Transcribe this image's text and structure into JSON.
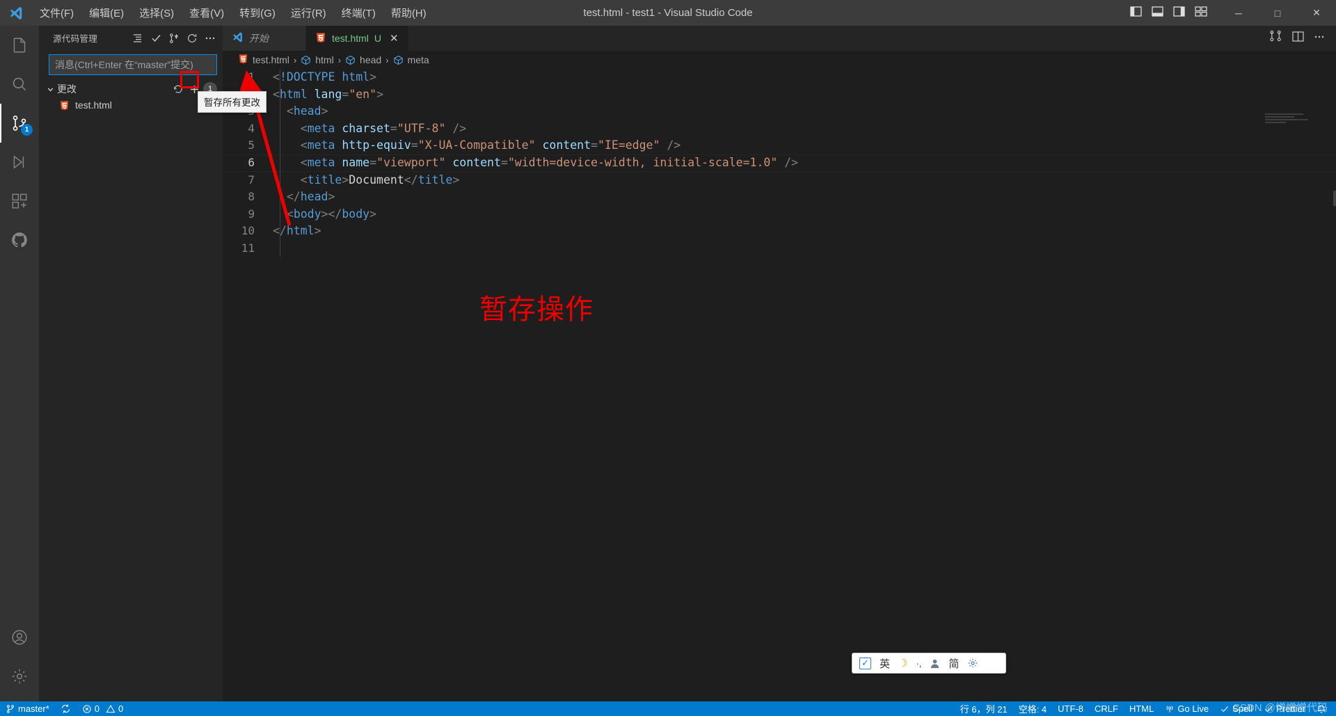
{
  "titlebar": {
    "logo_icon": "vscode-logo-icon",
    "title": "test.html - test1 - Visual Studio Code",
    "menus": [
      {
        "label": "文件(F)"
      },
      {
        "label": "编辑(E)"
      },
      {
        "label": "选择(S)"
      },
      {
        "label": "查看(V)"
      },
      {
        "label": "转到(G)"
      },
      {
        "label": "运行(R)"
      },
      {
        "label": "终端(T)"
      },
      {
        "label": "帮助(H)"
      }
    ],
    "layout_icons": [
      {
        "name": "toggle-primary-sidebar-icon"
      },
      {
        "name": "toggle-panel-icon"
      },
      {
        "name": "toggle-secondary-sidebar-icon"
      },
      {
        "name": "customize-layout-icon"
      }
    ],
    "window_controls": {
      "minimize": "─",
      "maximize": "□",
      "close": "✕"
    }
  },
  "activitybar": {
    "items": [
      {
        "name": "explorer",
        "icon": "files-icon",
        "badge": ""
      },
      {
        "name": "search",
        "icon": "search-icon",
        "badge": ""
      },
      {
        "name": "source-control",
        "icon": "source-control-icon",
        "badge": "1",
        "active": true
      },
      {
        "name": "run-and-debug",
        "icon": "debug-icon",
        "badge": ""
      },
      {
        "name": "extensions",
        "icon": "extensions-icon",
        "badge": ""
      },
      {
        "name": "github",
        "icon": "github-icon",
        "badge": ""
      }
    ],
    "bottom": [
      {
        "name": "accounts",
        "icon": "account-icon"
      },
      {
        "name": "manage",
        "icon": "gear-icon"
      }
    ]
  },
  "sidebar": {
    "title": "源代码管理",
    "header_actions": [
      {
        "name": "view-as-list",
        "icon": "list-icon"
      },
      {
        "name": "commit",
        "icon": "check-icon"
      },
      {
        "name": "more-branches",
        "icon": "branch-icon"
      },
      {
        "name": "refresh",
        "icon": "refresh-icon"
      },
      {
        "name": "views-and-more-actions",
        "icon": "ellipsis-icon"
      }
    ],
    "commit_input": {
      "placeholder": "消息(Ctrl+Enter 在“master”提交)",
      "value": ""
    },
    "changes_section": {
      "label": "更改",
      "chevron": "⌄",
      "discard_icon": "discard-changes-icon",
      "stage_all_icon": "plus-icon",
      "count": "1"
    },
    "files": [
      {
        "name": "test.html",
        "icon": "html5-icon"
      }
    ],
    "tooltip": "暂存所有更改"
  },
  "editor": {
    "tabs": [
      {
        "label": "开始",
        "icon": "vscode-logo-icon",
        "active": false,
        "dirty": ""
      },
      {
        "label": "test.html",
        "icon": "html5-icon",
        "active": true,
        "dirty": "U",
        "close": "✕"
      }
    ],
    "tab_actions": [
      {
        "name": "split-editor-right-icon"
      },
      {
        "name": "open-changes-icon"
      },
      {
        "name": "more-actions-icon"
      }
    ],
    "breadcrumb": [
      {
        "label": "test.html",
        "icon": "html5-icon"
      },
      {
        "label": "html",
        "icon": "symbol-cube-icon"
      },
      {
        "label": "head",
        "icon": "symbol-cube-icon"
      },
      {
        "label": "meta",
        "icon": "symbol-cube-icon"
      }
    ],
    "breadcrumb_separator": "›",
    "code_lines": [
      {
        "n": "1",
        "html": "<span class=\"tok-bracket\">&lt;</span><span class=\"tok-doctype\">!DOCTYPE</span> <span class=\"tok-doctype\" style=\"color:#569cd6\">html</span><span class=\"tok-bracket\">&gt;</span>"
      },
      {
        "n": "2",
        "html": "<span class=\"tok-bracket\">&lt;</span><span class=\"tok-tag\">html</span> <span class=\"tok-attr\">lang</span><span class=\"tok-punct\">=</span><span class=\"tok-str\">\"en\"</span><span class=\"tok-bracket\">&gt;</span>"
      },
      {
        "n": "3",
        "html": "  <span class=\"tok-bracket\">&lt;</span><span class=\"tok-tag\">head</span><span class=\"tok-bracket\">&gt;</span>"
      },
      {
        "n": "4",
        "html": "    <span class=\"tok-bracket\">&lt;</span><span class=\"tok-tag\">meta</span> <span class=\"tok-attr\">charset</span><span class=\"tok-punct\">=</span><span class=\"tok-str\">\"UTF-8\"</span> <span class=\"tok-bracket\">/&gt;</span>"
      },
      {
        "n": "5",
        "html": "    <span class=\"tok-bracket\">&lt;</span><span class=\"tok-tag\">meta</span> <span class=\"tok-attr\">http-equiv</span><span class=\"tok-punct\">=</span><span class=\"tok-str\">\"X-UA-Compatible\"</span> <span class=\"tok-attr\">content</span><span class=\"tok-punct\">=</span><span class=\"tok-str\">\"IE=edge\"</span> <span class=\"tok-bracket\">/&gt;</span>"
      },
      {
        "n": "6",
        "html": "    <span class=\"tok-bracket\">&lt;</span><span class=\"tok-tag\">meta</span> <span class=\"tok-attr\">name</span><span class=\"tok-punct\">=</span><span class=\"tok-str\">\"viewport\"</span> <span class=\"tok-attr\">content</span><span class=\"tok-punct\">=</span><span class=\"tok-str\">\"width=device-width, initial-scale=1.0\"</span> <span class=\"tok-bracket\">/&gt;</span>",
        "current": true
      },
      {
        "n": "7",
        "html": "    <span class=\"tok-bracket\">&lt;</span><span class=\"tok-tag\">title</span><span class=\"tok-bracket\">&gt;</span><span class=\"tok-text\">Document</span><span class=\"tok-bracket\">&lt;/</span><span class=\"tok-tag\">title</span><span class=\"tok-bracket\">&gt;</span>"
      },
      {
        "n": "8",
        "html": "  <span class=\"tok-bracket\">&lt;/</span><span class=\"tok-tag\">head</span><span class=\"tok-bracket\">&gt;</span>"
      },
      {
        "n": "9",
        "html": "  <span class=\"tok-bracket\">&lt;</span><span class=\"tok-tag\">body</span><span class=\"tok-bracket\">&gt;&lt;/</span><span class=\"tok-tag\">body</span><span class=\"tok-bracket\">&gt;</span>"
      },
      {
        "n": "10",
        "html": "<span class=\"tok-bracket\">&lt;/</span><span class=\"tok-tag\">html</span><span class=\"tok-bracket\">&gt;</span>"
      },
      {
        "n": "11",
        "html": ""
      }
    ]
  },
  "annotation": {
    "label": "暂存操作",
    "color": "#ee0000"
  },
  "ime_bar": {
    "items": [
      {
        "name": "ime-enabled-checkbox",
        "glyph": "✓"
      },
      {
        "name": "ime-language-mode",
        "glyph": "英"
      },
      {
        "name": "ime-moon-icon",
        "glyph": "☽"
      },
      {
        "name": "ime-punctuation-icon",
        "glyph": "·,"
      },
      {
        "name": "ime-user-icon",
        "glyph": "👤"
      },
      {
        "name": "ime-simplified-icon",
        "glyph": "简"
      },
      {
        "name": "ime-settings-icon",
        "glyph": "⚙"
      }
    ]
  },
  "statusbar": {
    "left": [
      {
        "name": "branch",
        "icon": "branch-icon",
        "label": "master*"
      },
      {
        "name": "sync",
        "icon": "sync-icon",
        "label": ""
      },
      {
        "name": "problems",
        "icon": "error-icon",
        "label": "0",
        "icon2": "warning-icon",
        "label2": "0"
      }
    ],
    "right": [
      {
        "name": "cursor-position",
        "label": "行 6，列 21"
      },
      {
        "name": "indentation",
        "label": "空格: 4"
      },
      {
        "name": "encoding",
        "label": "UTF-8"
      },
      {
        "name": "eol",
        "label": "CRLF"
      },
      {
        "name": "language-mode",
        "label": "HTML"
      },
      {
        "name": "go-live",
        "label": "Go Live",
        "icon": "broadcast-icon"
      },
      {
        "name": "spell-checker",
        "label": "Spell",
        "icon": "check-icon"
      },
      {
        "name": "prettier",
        "label": "Prettier",
        "icon": "check-icon"
      },
      {
        "name": "notifications",
        "label": "",
        "icon": "bell-icon"
      }
    ]
  },
  "watermark": "CSDN @憎憎憎代码"
}
